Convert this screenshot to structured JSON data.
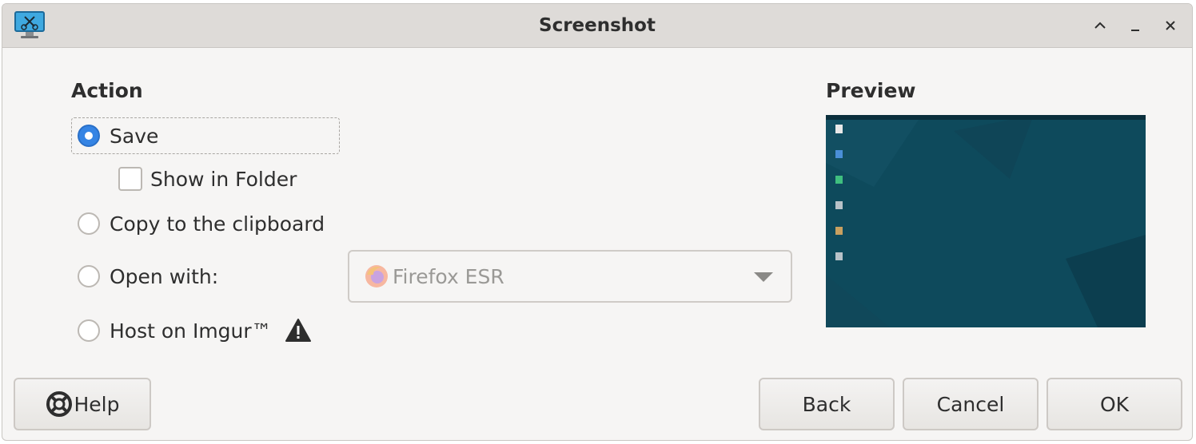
{
  "window": {
    "title": "Screenshot",
    "controls": [
      "maximize",
      "minimize",
      "close"
    ]
  },
  "action": {
    "heading": "Action",
    "options": [
      {
        "label": "Save",
        "selected": true
      },
      {
        "label": "Copy to the clipboard",
        "selected": false
      },
      {
        "label": "Open with:",
        "selected": false
      },
      {
        "label": "Host on Imgur™",
        "selected": false
      }
    ],
    "show_in_folder": {
      "label": "Show in Folder",
      "checked": false
    },
    "open_with_app": "Firefox ESR",
    "imgur_warning_icon": "warning-icon"
  },
  "preview": {
    "heading": "Preview",
    "background_color": "#0e4a5c"
  },
  "buttons": {
    "help": "Help",
    "back": "Back",
    "cancel": "Cancel",
    "ok": "OK"
  },
  "colors": {
    "accent": "#3584e4",
    "window_bg": "#f6f5f4",
    "titlebar_bg": "#dedbd8"
  }
}
